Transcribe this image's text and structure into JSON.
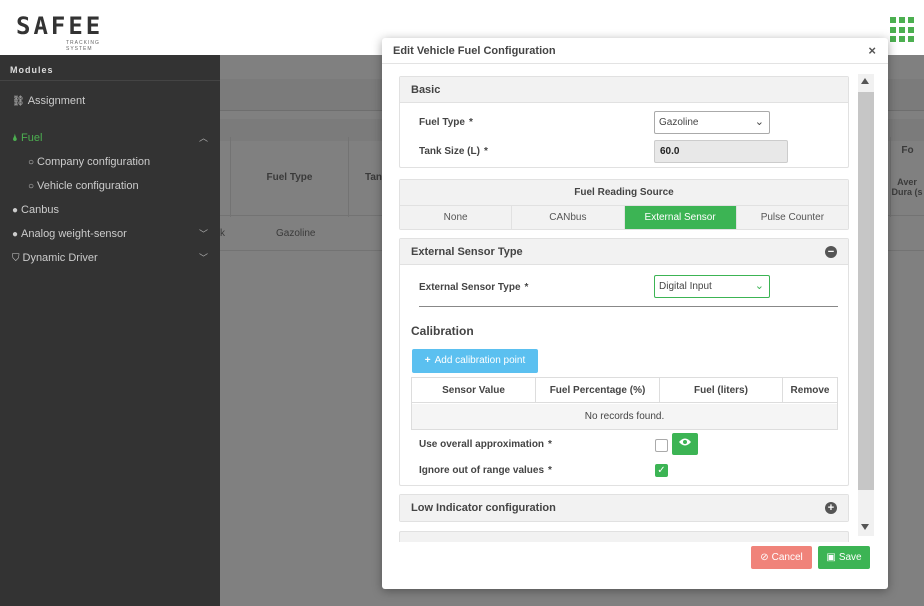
{
  "app": {
    "logo_text": "SAFEE",
    "logo_sub": "TRACKING SYSTEM"
  },
  "sidebar": {
    "heading": "Modules",
    "items": [
      {
        "label": "Assignment",
        "icon": "link-icon"
      },
      {
        "label": "Fuel",
        "icon": "fuel-icon",
        "active": true
      },
      {
        "label": "Company configuration",
        "icon": "circle-icon"
      },
      {
        "label": "Vehicle configuration",
        "icon": "circle-icon"
      },
      {
        "label": "Canbus",
        "icon": "dot-icon"
      },
      {
        "label": "Analog weight-sensor",
        "icon": "dot-icon"
      },
      {
        "label": "Dynamic Driver",
        "icon": "shield-icon"
      }
    ]
  },
  "background_table": {
    "headers": [
      "Fuel Type",
      "Tan",
      "Fo",
      "Aver Dura (s"
    ],
    "row": {
      "prefix": "k",
      "fuel_type": "Gazoline"
    }
  },
  "modal": {
    "title": "Edit Vehicle Fuel Configuration",
    "close": "×",
    "basic": {
      "title": "Basic",
      "fuel_type_label": "Fuel Type",
      "fuel_type_value": "Gazoline",
      "tank_size_label": "Tank Size (L)",
      "tank_size_value": "60.0",
      "required": "*"
    },
    "reading_source": {
      "title": "Fuel Reading Source",
      "tabs": [
        "None",
        "CANbus",
        "External Sensor",
        "Pulse Counter"
      ],
      "active": "External Sensor"
    },
    "external_sensor": {
      "title": "External Sensor Type",
      "type_label": "External Sensor Type",
      "type_value": "Digital Input",
      "calibration_title": "Calibration",
      "add_button": "Add calibration point",
      "columns": [
        "Sensor Value",
        "Fuel Percentage (%)",
        "Fuel (liters)",
        "Remove"
      ],
      "empty": "No records found.",
      "approx_label": "Use overall approximation",
      "approx_checked": false,
      "ignore_label": "Ignore out of range values",
      "ignore_checked": true
    },
    "low_indicator": {
      "title": "Low Indicator configuration"
    },
    "buttons": {
      "cancel": "Cancel",
      "save": "Save"
    }
  },
  "colors": {
    "accent": "#3cb454",
    "info": "#5bc0f0",
    "danger": "#f0837a",
    "sidebar": "#333333"
  }
}
